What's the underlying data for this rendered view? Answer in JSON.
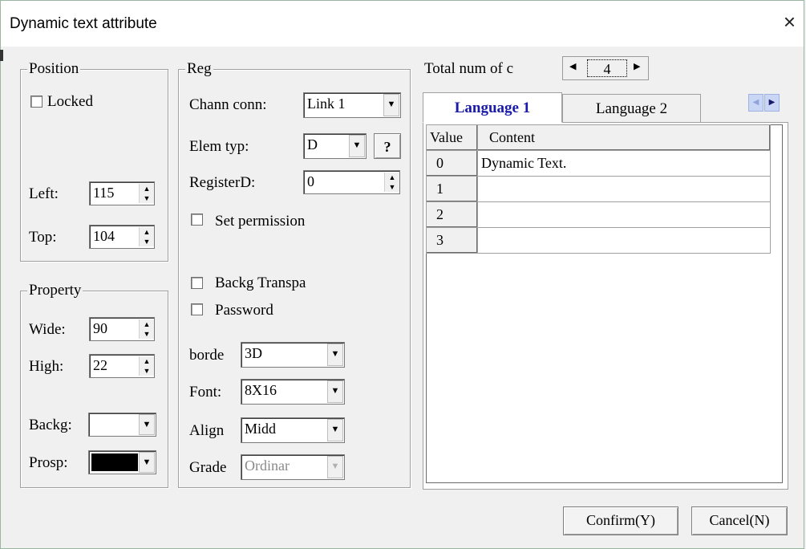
{
  "window": {
    "title": "Dynamic text attribute",
    "close_glyph": "×"
  },
  "position": {
    "title": "Position",
    "locked_label": "Locked",
    "left_label": "Left:",
    "left_value": "115",
    "top_label": "Top:",
    "top_value": "104"
  },
  "property": {
    "title": "Property",
    "wide_label": "Wide:",
    "wide_value": "90",
    "high_label": "High:",
    "high_value": "22",
    "backg_label": "Backg:",
    "backg_color": "#ffffff",
    "prosp_label": "Prosp:",
    "prosp_color": "#000000"
  },
  "reg": {
    "title": "Reg",
    "chann_label": "Chann conn:",
    "chann_value": "Link 1",
    "elem_label": "Elem typ:",
    "elem_value": "D",
    "help_label": "?",
    "register_label": "RegisterD:",
    "register_value": "0",
    "set_permission_label": "Set permission",
    "backg_transpa_label": "Backg Transpa",
    "password_label": "Password",
    "borde_label": "borde",
    "borde_value": "3D",
    "font_label": "Font:",
    "font_value": "8X16",
    "align_label": "Align",
    "align_value": "Midd",
    "grade_label": "Grade",
    "grade_value": "Ordinar"
  },
  "languages": {
    "total_label": "Total num of c",
    "total_value": "4",
    "tabs": [
      "Language 1",
      "Language 2"
    ],
    "active_tab": 0,
    "columns": [
      "Value",
      "Content"
    ],
    "rows": [
      {
        "value": "0",
        "content": "Dynamic Text."
      },
      {
        "value": "1",
        "content": ""
      },
      {
        "value": "2",
        "content": ""
      },
      {
        "value": "3",
        "content": ""
      }
    ]
  },
  "buttons": {
    "confirm": "Confirm(Y)",
    "cancel": "Cancel(N)"
  },
  "colors": {
    "accent_tab_text": "#1a1aa8",
    "window_border": "#9bb6a0"
  }
}
